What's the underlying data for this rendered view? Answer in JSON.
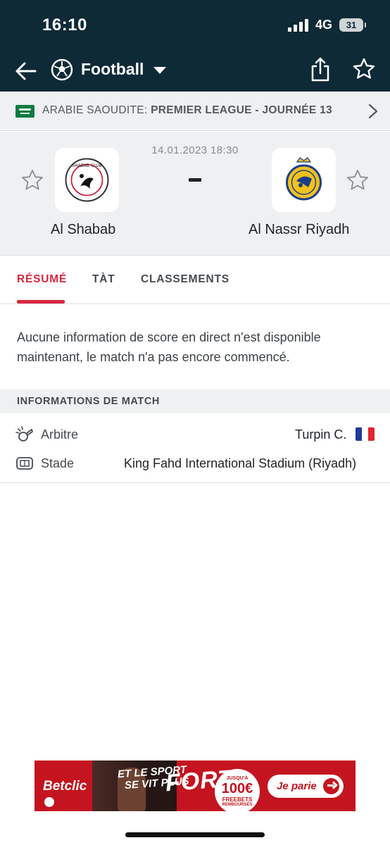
{
  "status_bar": {
    "time": "16:10",
    "network": "4G",
    "battery": "31"
  },
  "nav": {
    "title": "Football",
    "back_icon": "back-arrow-icon",
    "sport_icon": "soccer-ball-icon",
    "share_icon": "share-icon",
    "favorite_icon": "star-icon"
  },
  "league": {
    "flag_icon": "saudi-arabia-flag",
    "country": "ARABIE SAOUDITE:",
    "competition": "PREMIER LEAGUE - JOURNÉE 13"
  },
  "match": {
    "datetime": "14.01.2023 18:30",
    "home": {
      "name": "Al Shabab",
      "logo": "al-shabab-logo"
    },
    "away": {
      "name": "Al Nassr Riyadh",
      "logo": "al-nassr-logo"
    }
  },
  "tabs": [
    {
      "label": "RÉSUMÉ",
      "active": true
    },
    {
      "label": "TÀT",
      "active": false
    },
    {
      "label": "CLASSEMENTS",
      "active": false
    }
  ],
  "summary_message": "Aucune information de score en direct n'est disponible maintenant, le match n'a pas encore commencé.",
  "match_info": {
    "heading": "INFORMATIONS DE MATCH",
    "referee": {
      "label": "Arbitre",
      "value": "Turpin C.",
      "icon": "whistle-icon",
      "flag": "france-flag"
    },
    "venue": {
      "label": "Stade",
      "value": "King Fahd International Stadium (Riyadh)",
      "icon": "stadium-icon"
    }
  },
  "ad": {
    "brand": "Betclic",
    "line1": "ET LE SPORT",
    "line2": "SE VIT PLUS",
    "line3": "FORT",
    "badge_top": "JUSQU'À",
    "badge_amount": "100€",
    "badge_mid": "FREEBETS",
    "badge_bottom": "REMBOURSÉS",
    "cta": "Je parie"
  },
  "colors": {
    "header_bg": "#0e2a36",
    "accent": "#d8263f",
    "panel_bg": "#eef0f1",
    "ad_bg": "#c4141f"
  }
}
